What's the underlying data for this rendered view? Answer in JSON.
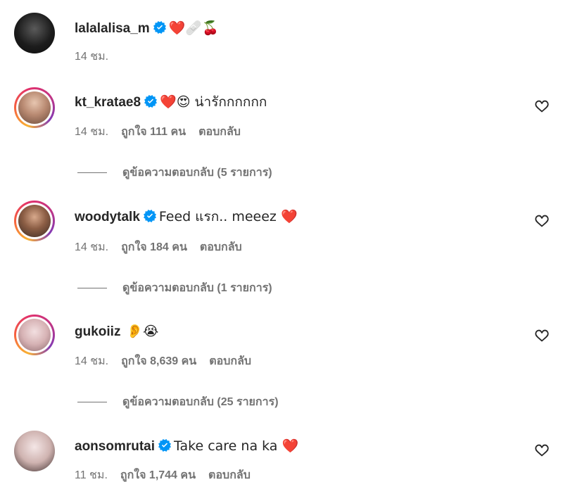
{
  "post": {
    "username": "lalalalisa_m",
    "caption": "❤️🩹🍒",
    "time": "14 ชม."
  },
  "comments": [
    {
      "username": "kt_kratae8",
      "text": "❤️😍 น่ารักกกกกก",
      "time": "14 ชม.",
      "likes": "ถูกใจ 111 คน",
      "reply_label": "ตอบกลับ",
      "view_replies": "ดูข้อความตอบกลับ (5 รายการ)"
    },
    {
      "username": "woodytalk",
      "text": "Feed แรก.. meeez ❤️",
      "time": "14 ชม.",
      "likes": "ถูกใจ 184 คน",
      "reply_label": "ตอบกลับ",
      "view_replies": "ดูข้อความตอบกลับ (1 รายการ)"
    },
    {
      "username": "gukoiiz",
      "text": "👂😭",
      "time": "14 ชม.",
      "likes": "ถูกใจ 8,639 คน",
      "reply_label": "ตอบกลับ",
      "view_replies": "ดูข้อความตอบกลับ (25 รายการ)"
    },
    {
      "username": "aonsomrutai",
      "text": "Take care na ka ❤️",
      "time": "11 ชม.",
      "likes": "ถูกใจ 1,744 คน",
      "reply_label": "ตอบกลับ"
    }
  ],
  "colors": {
    "verified": "#0095f6",
    "meta": "#737373",
    "text": "#262626"
  }
}
